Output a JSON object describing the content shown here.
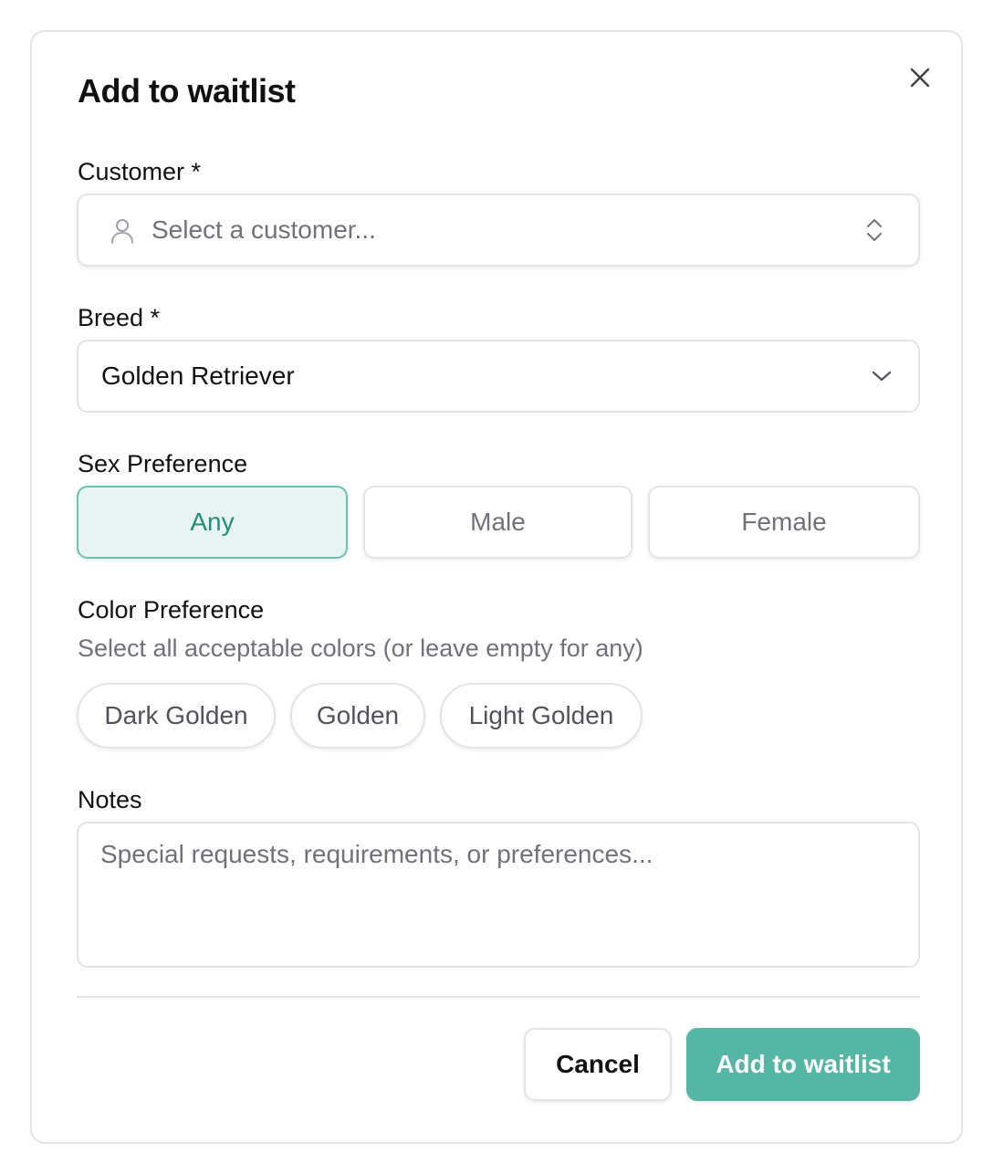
{
  "dialog": {
    "title": "Add to waitlist",
    "close_icon": "close-icon"
  },
  "customer": {
    "label": "Customer *",
    "placeholder": "Select a customer...",
    "icon": "user-icon",
    "trailing_icon": "chevron-up-down-icon"
  },
  "breed": {
    "label": "Breed *",
    "value": "Golden Retriever",
    "trailing_icon": "chevron-down-icon"
  },
  "sex_preference": {
    "label": "Sex Preference",
    "options": [
      "Any",
      "Male",
      "Female"
    ],
    "selected": "Any"
  },
  "color_preference": {
    "label": "Color Preference",
    "hint": "Select all acceptable colors (or leave empty for any)",
    "options": [
      "Dark Golden",
      "Golden",
      "Light Golden"
    ]
  },
  "notes": {
    "label": "Notes",
    "placeholder": "Special requests, requirements, or preferences..."
  },
  "actions": {
    "cancel_label": "Cancel",
    "submit_label": "Add to waitlist"
  },
  "colors": {
    "accent": "#56b6a6",
    "selected_bg": "#e8f4f1",
    "selected_text": "#1f8f7a",
    "border": "#e4e4e7",
    "muted_text": "#71717a"
  }
}
